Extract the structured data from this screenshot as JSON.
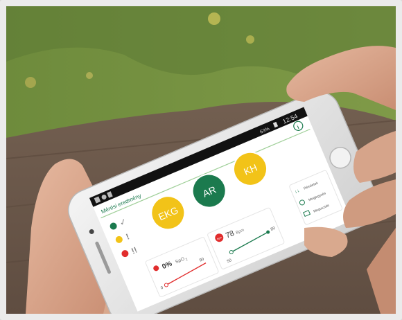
{
  "status_bar": {
    "time": "12:54",
    "battery": "63%"
  },
  "app": {
    "header_title": "Mérési eredmény",
    "legend": [
      {
        "color": "#1b7a4e",
        "symbol": "✓"
      },
      {
        "color": "#f2c318",
        "symbol": "!"
      },
      {
        "color": "#e12d2d",
        "symbol": "!!"
      }
    ],
    "buttons": [
      {
        "label": "EKG",
        "color": "#f2c318"
      },
      {
        "label": "AR",
        "color": "#1b7a4e"
      },
      {
        "label": "KH",
        "color": "#f2c318"
      }
    ],
    "spo2": {
      "value": "0%",
      "unit": "SpO",
      "unit_sub": "2",
      "range_min": "0",
      "range_max": "90"
    },
    "pulse": {
      "value": "78",
      "unit": "Bpm",
      "icon_text": "Bpm",
      "range_min": "50",
      "range_max": "80"
    },
    "side_menu": [
      "Részletek",
      "Megjegyzés",
      "Megosztás"
    ]
  },
  "colors": {
    "green": "#1b7a4e",
    "yellow": "#f2c318",
    "red": "#e12d2d"
  }
}
